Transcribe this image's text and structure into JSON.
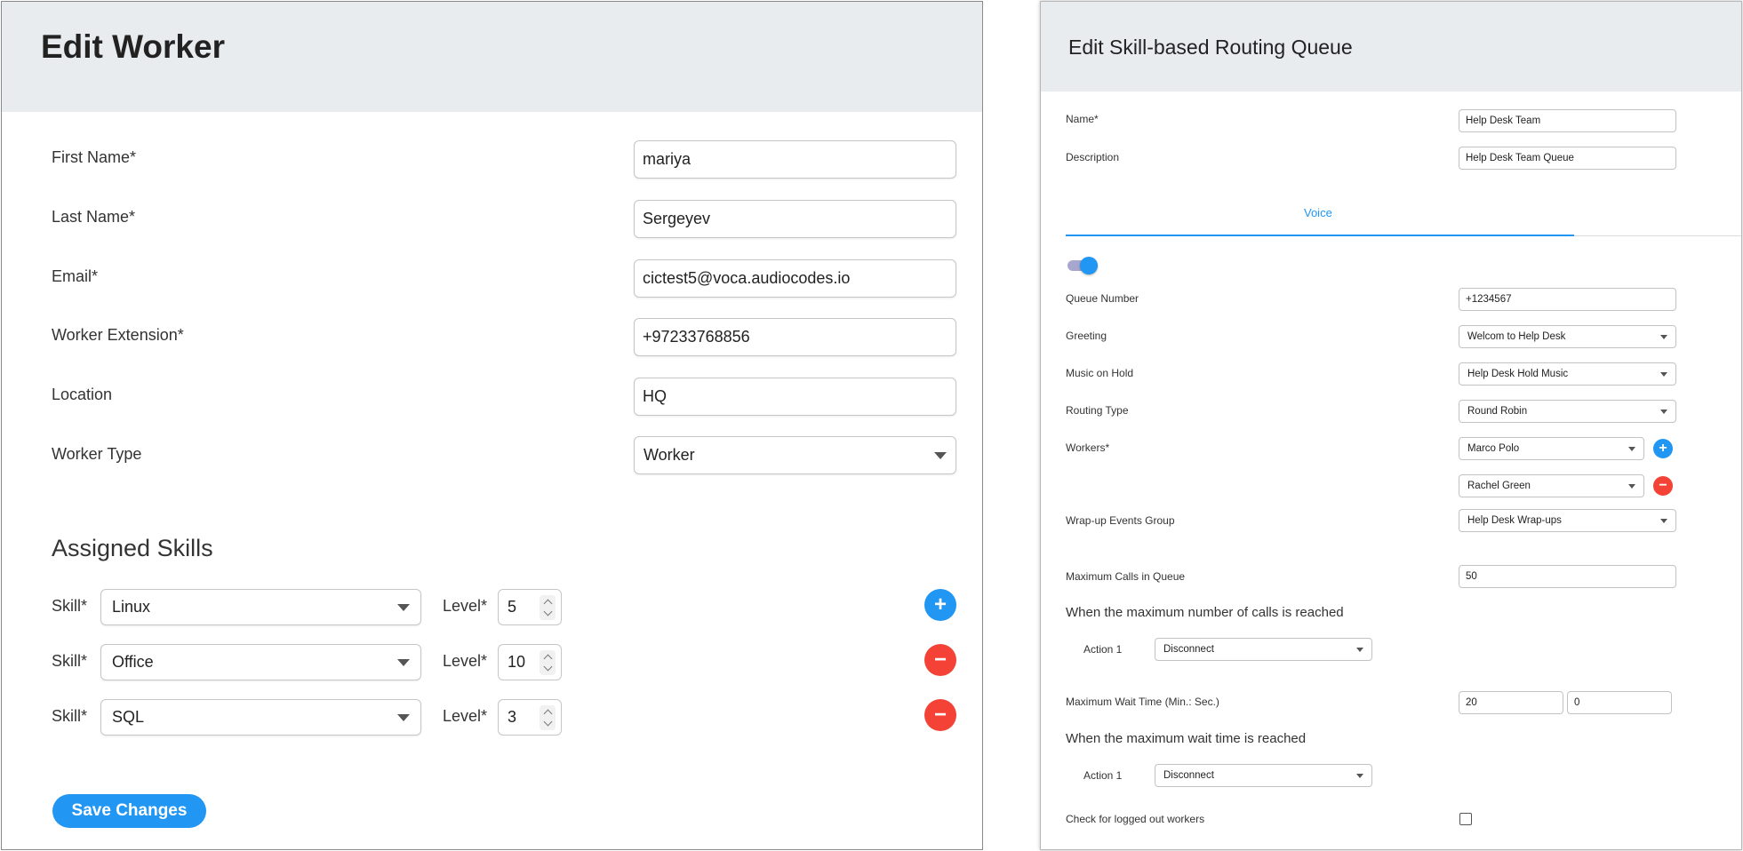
{
  "edit_worker": {
    "title": "Edit Worker",
    "fields": {
      "first_name": {
        "label": "First Name*",
        "value": "mariya"
      },
      "last_name": {
        "label": "Last Name*",
        "value": "Sergeyev"
      },
      "email": {
        "label": "Email*",
        "value": "cictest5@voca.audiocodes.io"
      },
      "extension": {
        "label": "Worker Extension*",
        "value": "+97233768856"
      },
      "location": {
        "label": "Location",
        "value": "HQ"
      },
      "worker_type": {
        "label": "Worker Type",
        "value": "Worker"
      }
    },
    "skills_section_title": "Assigned Skills",
    "skills": [
      {
        "skill_label": "Skill*",
        "skill": "Linux",
        "level_label": "Level*",
        "level": "5",
        "action": "+"
      },
      {
        "skill_label": "Skill*",
        "skill": "Office",
        "level_label": "Level*",
        "level": "10",
        "action": "−"
      },
      {
        "skill_label": "Skill*",
        "skill": "SQL",
        "level_label": "Level*",
        "level": "3",
        "action": "−"
      }
    ],
    "save_label": "Save Changes",
    "colors": {
      "primary": "#2196f3",
      "danger": "#f44336",
      "header_bg": "#e9ecef"
    }
  },
  "edit_queue": {
    "title": "Edit Skill-based Routing Queue",
    "name": {
      "label": "Name*",
      "value": "Help Desk Team"
    },
    "description": {
      "label": "Description",
      "value": "Help Desk Team Queue"
    },
    "tab_label": "Voice",
    "toggle_on": true,
    "queue_number": {
      "label": "Queue Number",
      "value": "+1234567"
    },
    "greeting": {
      "label": "Greeting",
      "value": "Welcom to Help Desk"
    },
    "music_on_hold": {
      "label": "Music on Hold",
      "value": "Help Desk Hold Music"
    },
    "routing_type": {
      "label": "Routing Type",
      "value": "Round Robin"
    },
    "workers": {
      "label": "Workers*",
      "items": [
        "Marco Polo",
        "Rachel Green"
      ],
      "add": "+",
      "remove": "−"
    },
    "wrapup": {
      "label": "Wrap-up Events Group",
      "value": "Help Desk Wrap-ups"
    },
    "max_calls": {
      "label": "Maximum Calls in Queue",
      "value": "50"
    },
    "max_calls_reached_title": "When the maximum number of calls is reached",
    "max_calls_action": {
      "label": "Action 1",
      "value": "Disconnect"
    },
    "max_wait": {
      "label": "Maximum Wait Time (Min.: Sec.)",
      "min": "20",
      "sec": "0"
    },
    "max_wait_reached_title": "When the maximum wait time is reached",
    "max_wait_action": {
      "label": "Action 1",
      "value": "Disconnect"
    },
    "logged_out": {
      "label": "Check for logged out workers",
      "checked": false
    }
  }
}
